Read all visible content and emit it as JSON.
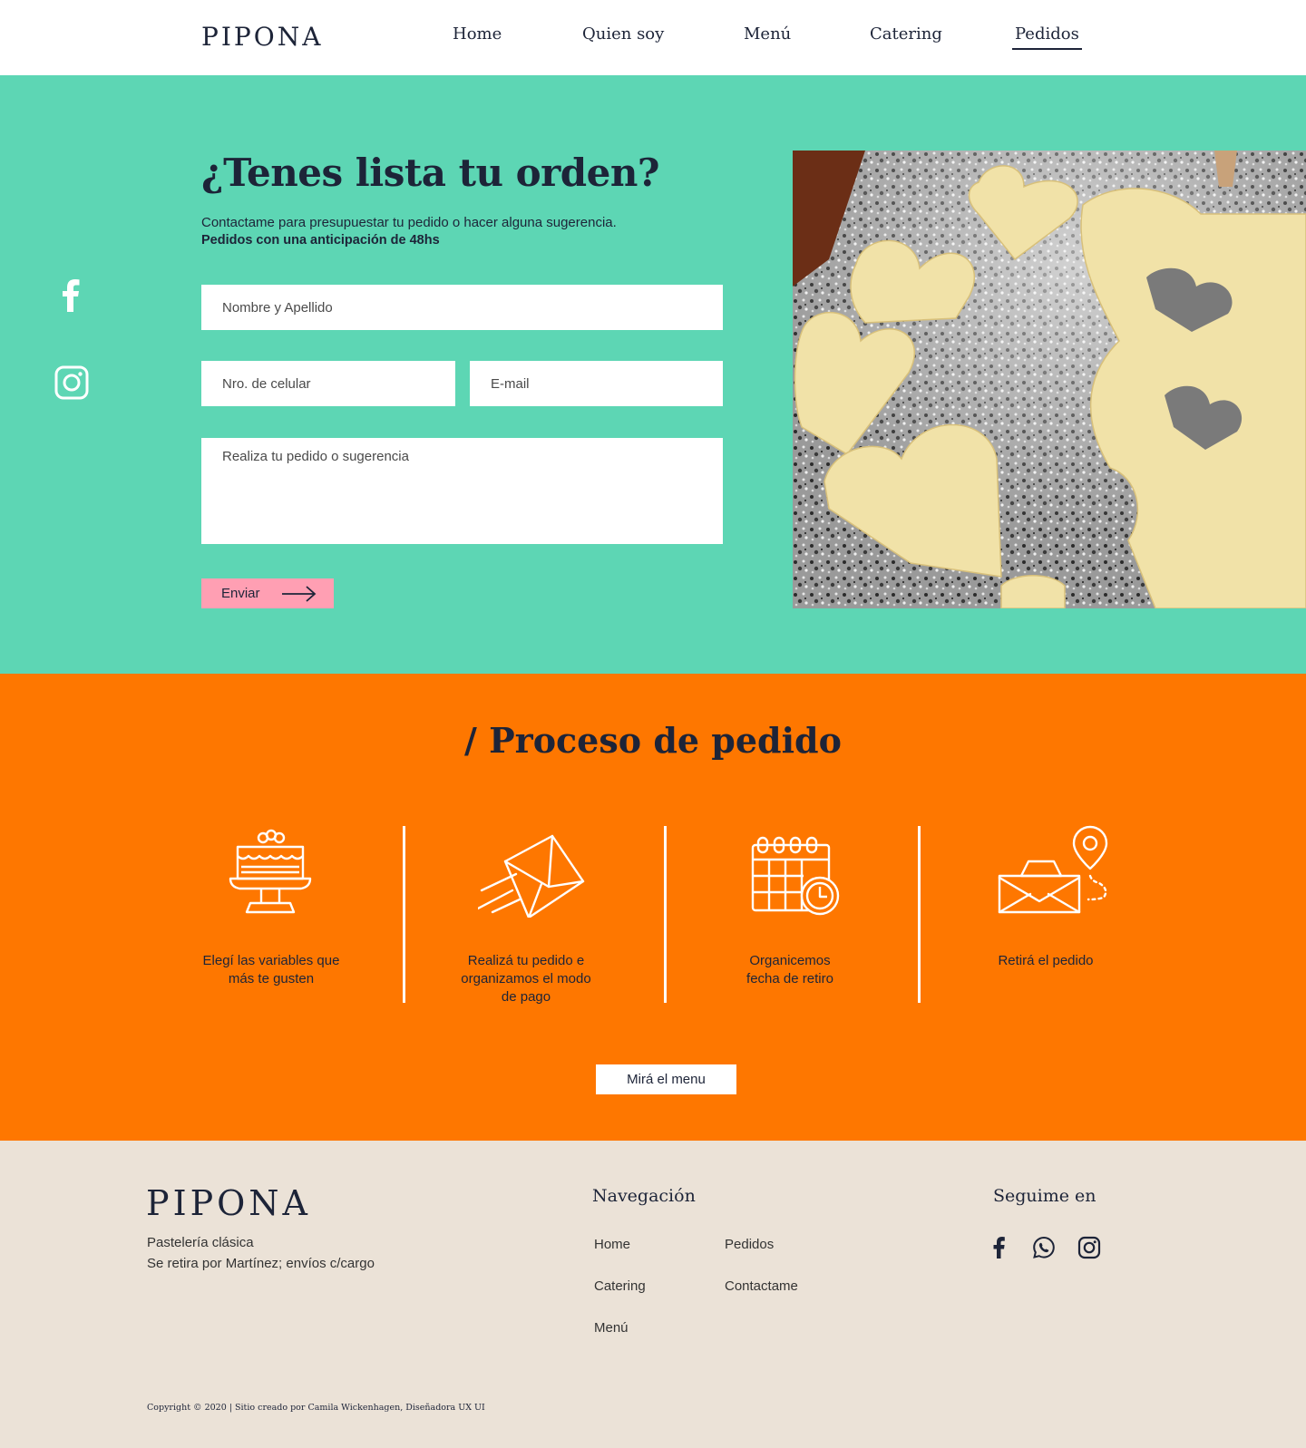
{
  "header": {
    "logo": "PIPONA",
    "nav": [
      "Home",
      "Quien soy",
      "Menú",
      "Catering",
      "Pedidos"
    ],
    "active": "Pedidos"
  },
  "hero": {
    "title": "¿Tenes lista tu orden?",
    "subtitle": "Contactame para presupuestar tu pedido o hacer alguna sugerencia.",
    "subtitle_bold": "Pedidos con una anticipación de 48hs",
    "form": {
      "name_placeholder": "Nombre y Apellido",
      "phone_placeholder": "Nro. de celular",
      "email_placeholder": "E-mail",
      "message_placeholder": "Realiza tu pedido o sugerencia",
      "submit_label": "Enviar"
    },
    "social_icons": [
      "facebook-icon",
      "instagram-icon"
    ],
    "image": "heart-shaped-cookie-dough-photo"
  },
  "process": {
    "title": "/ Proceso de pedido",
    "steps": [
      {
        "icon": "cake-stand-icon",
        "label_line1": "Elegí las variables que",
        "label_line2": "más te gusten",
        "label_line3": ""
      },
      {
        "icon": "flying-envelope-icon",
        "label_line1": "Realizá tu pedido e",
        "label_line2": "organizamos el modo",
        "label_line3": "de pago"
      },
      {
        "icon": "calendar-clock-icon",
        "label_line1": "Organicemos",
        "label_line2": "fecha de retiro",
        "label_line3": ""
      },
      {
        "icon": "package-location-icon",
        "label_line1": "Retirá el pedido",
        "label_line2": "",
        "label_line3": ""
      }
    ],
    "cta_label": "Mirá el menu"
  },
  "footer": {
    "logo": "PIPONA",
    "desc_line1": "Pastelería clásica",
    "desc_line2": "Se retira por Martínez; envíos c/cargo",
    "nav_heading": "Navegación",
    "nav_links": [
      "Home",
      "Pedidos",
      "Catering",
      "Contactame",
      "Menú"
    ],
    "social_heading": "Seguime en",
    "social_icons": [
      "facebook-icon",
      "whatsapp-icon",
      "instagram-icon"
    ],
    "copyright": "Copyright © 2020 | Sitio creado por Camila Wickenhagen, Diseñadora UX UI"
  },
  "colors": {
    "hero_bg": "#5dd6b4",
    "process_bg": "#fe7700",
    "footer_bg": "#ebe2d7",
    "button_pink": "#ff9fb3",
    "text_dark": "#1d2438"
  }
}
